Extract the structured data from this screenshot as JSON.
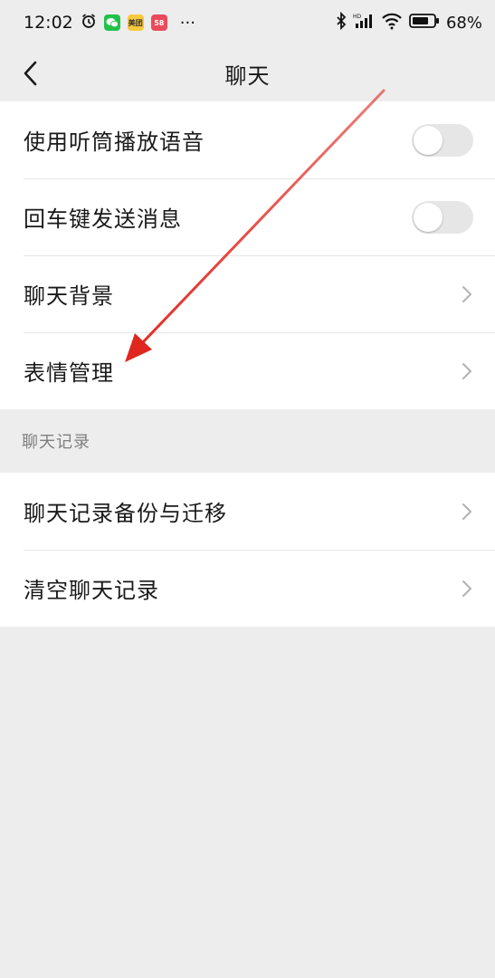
{
  "statusbar": {
    "time": "12:02",
    "apps": [
      {
        "name": "alarm-icon"
      },
      {
        "name": "wechat-icon",
        "color": "#22c14a"
      },
      {
        "name": "meituan-icon",
        "color": "#f7c93c",
        "text": "美团"
      },
      {
        "name": "app-icon",
        "color": "#ea4a5a",
        "text": "58"
      }
    ],
    "more": "···",
    "battery": "68%"
  },
  "nav": {
    "title": "聊天"
  },
  "settings": [
    {
      "label": "使用听筒播放语音",
      "type": "toggle",
      "on": false
    },
    {
      "label": "回车键发送消息",
      "type": "toggle",
      "on": false
    },
    {
      "label": "聊天背景",
      "type": "link"
    },
    {
      "label": "表情管理",
      "type": "link"
    }
  ],
  "history": {
    "header": "聊天记录",
    "items": [
      {
        "label": "聊天记录备份与迁移",
        "type": "link"
      },
      {
        "label": "清空聊天记录",
        "type": "link"
      }
    ]
  },
  "colors": {
    "background": "#ededed",
    "annotation_arrow": "#e0261f"
  }
}
